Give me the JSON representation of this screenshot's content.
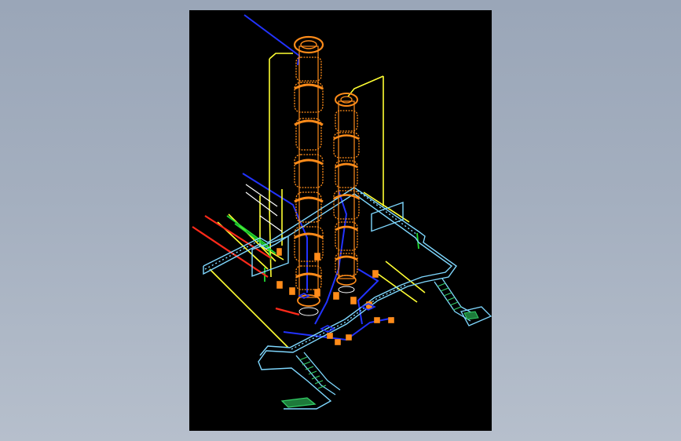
{
  "viewer": {
    "background_color": "#a4afbf",
    "canvas_color": "#000000"
  },
  "drawing": {
    "subject": "isometric-plant-structure",
    "colors": {
      "column": "#ff8c1a",
      "platform": "#7fd8ff",
      "pipe_yellow": "#ffff33",
      "pipe_blue": "#2233ff",
      "pipe_red": "#ff2a1a",
      "pipe_green": "#22dd33",
      "pipe_white": "#ffffff",
      "stair_green": "#33cc66"
    }
  }
}
